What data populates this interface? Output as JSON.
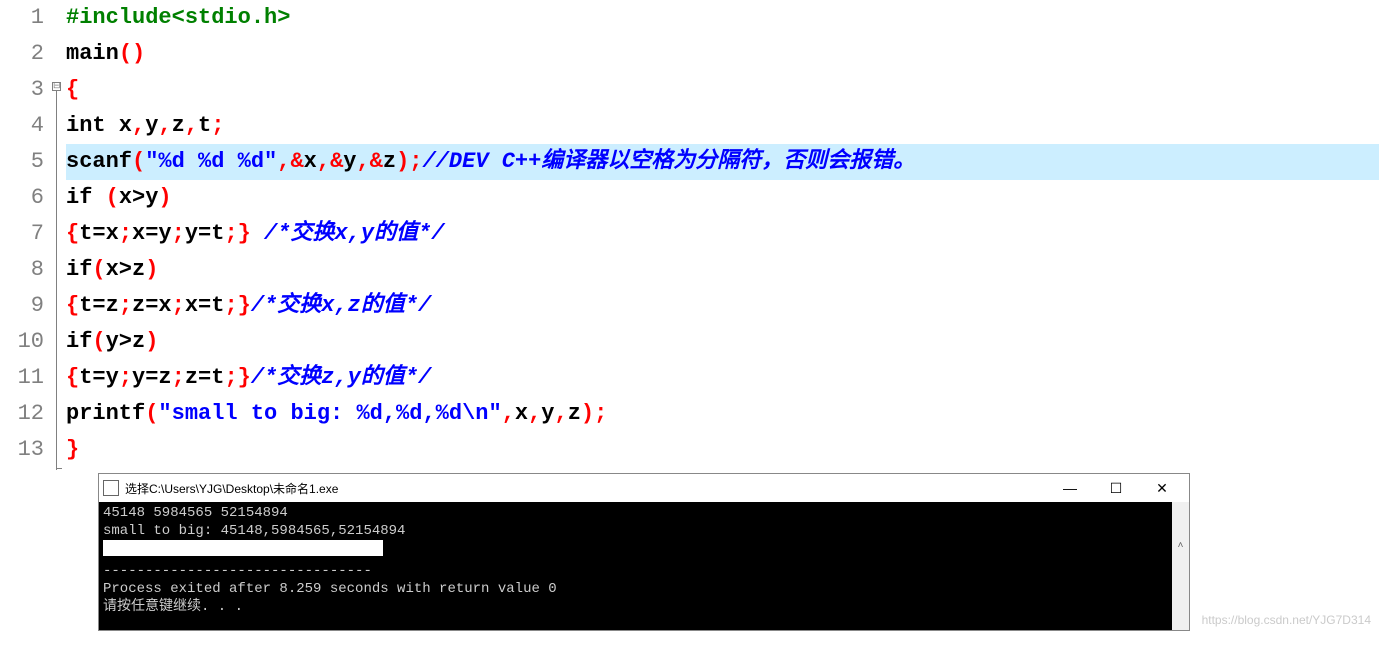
{
  "gutter": [
    "1",
    "2",
    "3",
    "4",
    "5",
    "6",
    "7",
    "8",
    "9",
    "10",
    "11",
    "12",
    "13"
  ],
  "fold_marker": "⊟",
  "code": {
    "l1_preproc": "#include<stdio.h>",
    "l2_kw": "main",
    "l4_kw": "int",
    "l4_vars": " x",
    "l4_v2": "y",
    "l4_v3": "z",
    "l4_v4": "t",
    "l5_fn": "scanf",
    "l5_str": "\"%d %d %d\"",
    "l5_a1": "&",
    "l5_x": "x",
    "l5_y": "y",
    "l5_z": "z",
    "l5_comment": "//DEV C++编译器以空格为分隔符，否则会报错。",
    "l6_kw": "if",
    "l6_cond": "x>y",
    "l7_body": "t=x",
    "l7_b2": "x=y",
    "l7_b3": "y=t",
    "l7_comment": " /*交换x,y的值*/",
    "l8_kw": "if",
    "l8_cond": "x>z",
    "l9_b1": "t=z",
    "l9_b2": "z=x",
    "l9_b3": "x=t",
    "l9_comment": "/*交换x,z的值*/",
    "l10_kw": "if",
    "l10_cond": "y>z",
    "l11_b1": "t=y",
    "l11_b2": "y=z",
    "l11_b3": "z=t",
    "l11_comment": "/*交换z,y的值*/",
    "l12_fn": "printf",
    "l12_str": "\"small to big: %d,%d,%d\\n\"",
    "l12_x": "x",
    "l12_y": "y",
    "l12_z": "z"
  },
  "console": {
    "title": "选择C:\\Users\\YJG\\Desktop\\未命名1.exe",
    "line1": "45148 5984565 52154894",
    "line2": "small to big: 45148,5984565,52154894",
    "dashes": "--------------------------------",
    "line3": "Process exited after 8.259 seconds with return value 0",
    "line4": "请按任意键继续. . ."
  },
  "win_min": "—",
  "win_max": "☐",
  "win_close": "✕",
  "scroll_up": "˄",
  "watermark": "https://blog.csdn.net/YJG7D314"
}
